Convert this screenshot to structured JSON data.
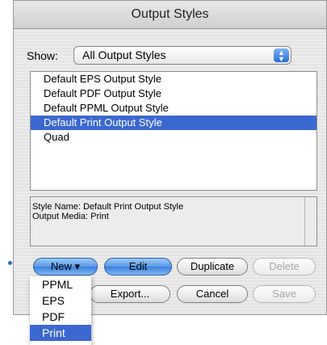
{
  "window": {
    "title": "Output Styles"
  },
  "show": {
    "label": "Show:",
    "selected": "All Output Styles"
  },
  "list": {
    "items": [
      {
        "label": "Default EPS Output Style",
        "selected": false
      },
      {
        "label": "Default PDF Output Style",
        "selected": false
      },
      {
        "label": "Default PPML Output Style",
        "selected": false
      },
      {
        "label": "Default Print Output Style",
        "selected": true
      },
      {
        "label": "Quad",
        "selected": false
      }
    ]
  },
  "info": {
    "style_name": "Style Name: Default Print Output Style",
    "output_media": "Output Media: Print"
  },
  "buttons": {
    "new": "New ▾",
    "edit": "Edit",
    "duplicate": "Duplicate",
    "delete": "Delete",
    "export": "Export...",
    "cancel": "Cancel",
    "save": "Save"
  },
  "new_menu": {
    "items": [
      "PPML",
      "EPS",
      "PDF",
      "Print"
    ],
    "highlighted": "Print"
  },
  "colors": {
    "selection": "#3a68cf",
    "accent_blue": "#5b9be6"
  }
}
